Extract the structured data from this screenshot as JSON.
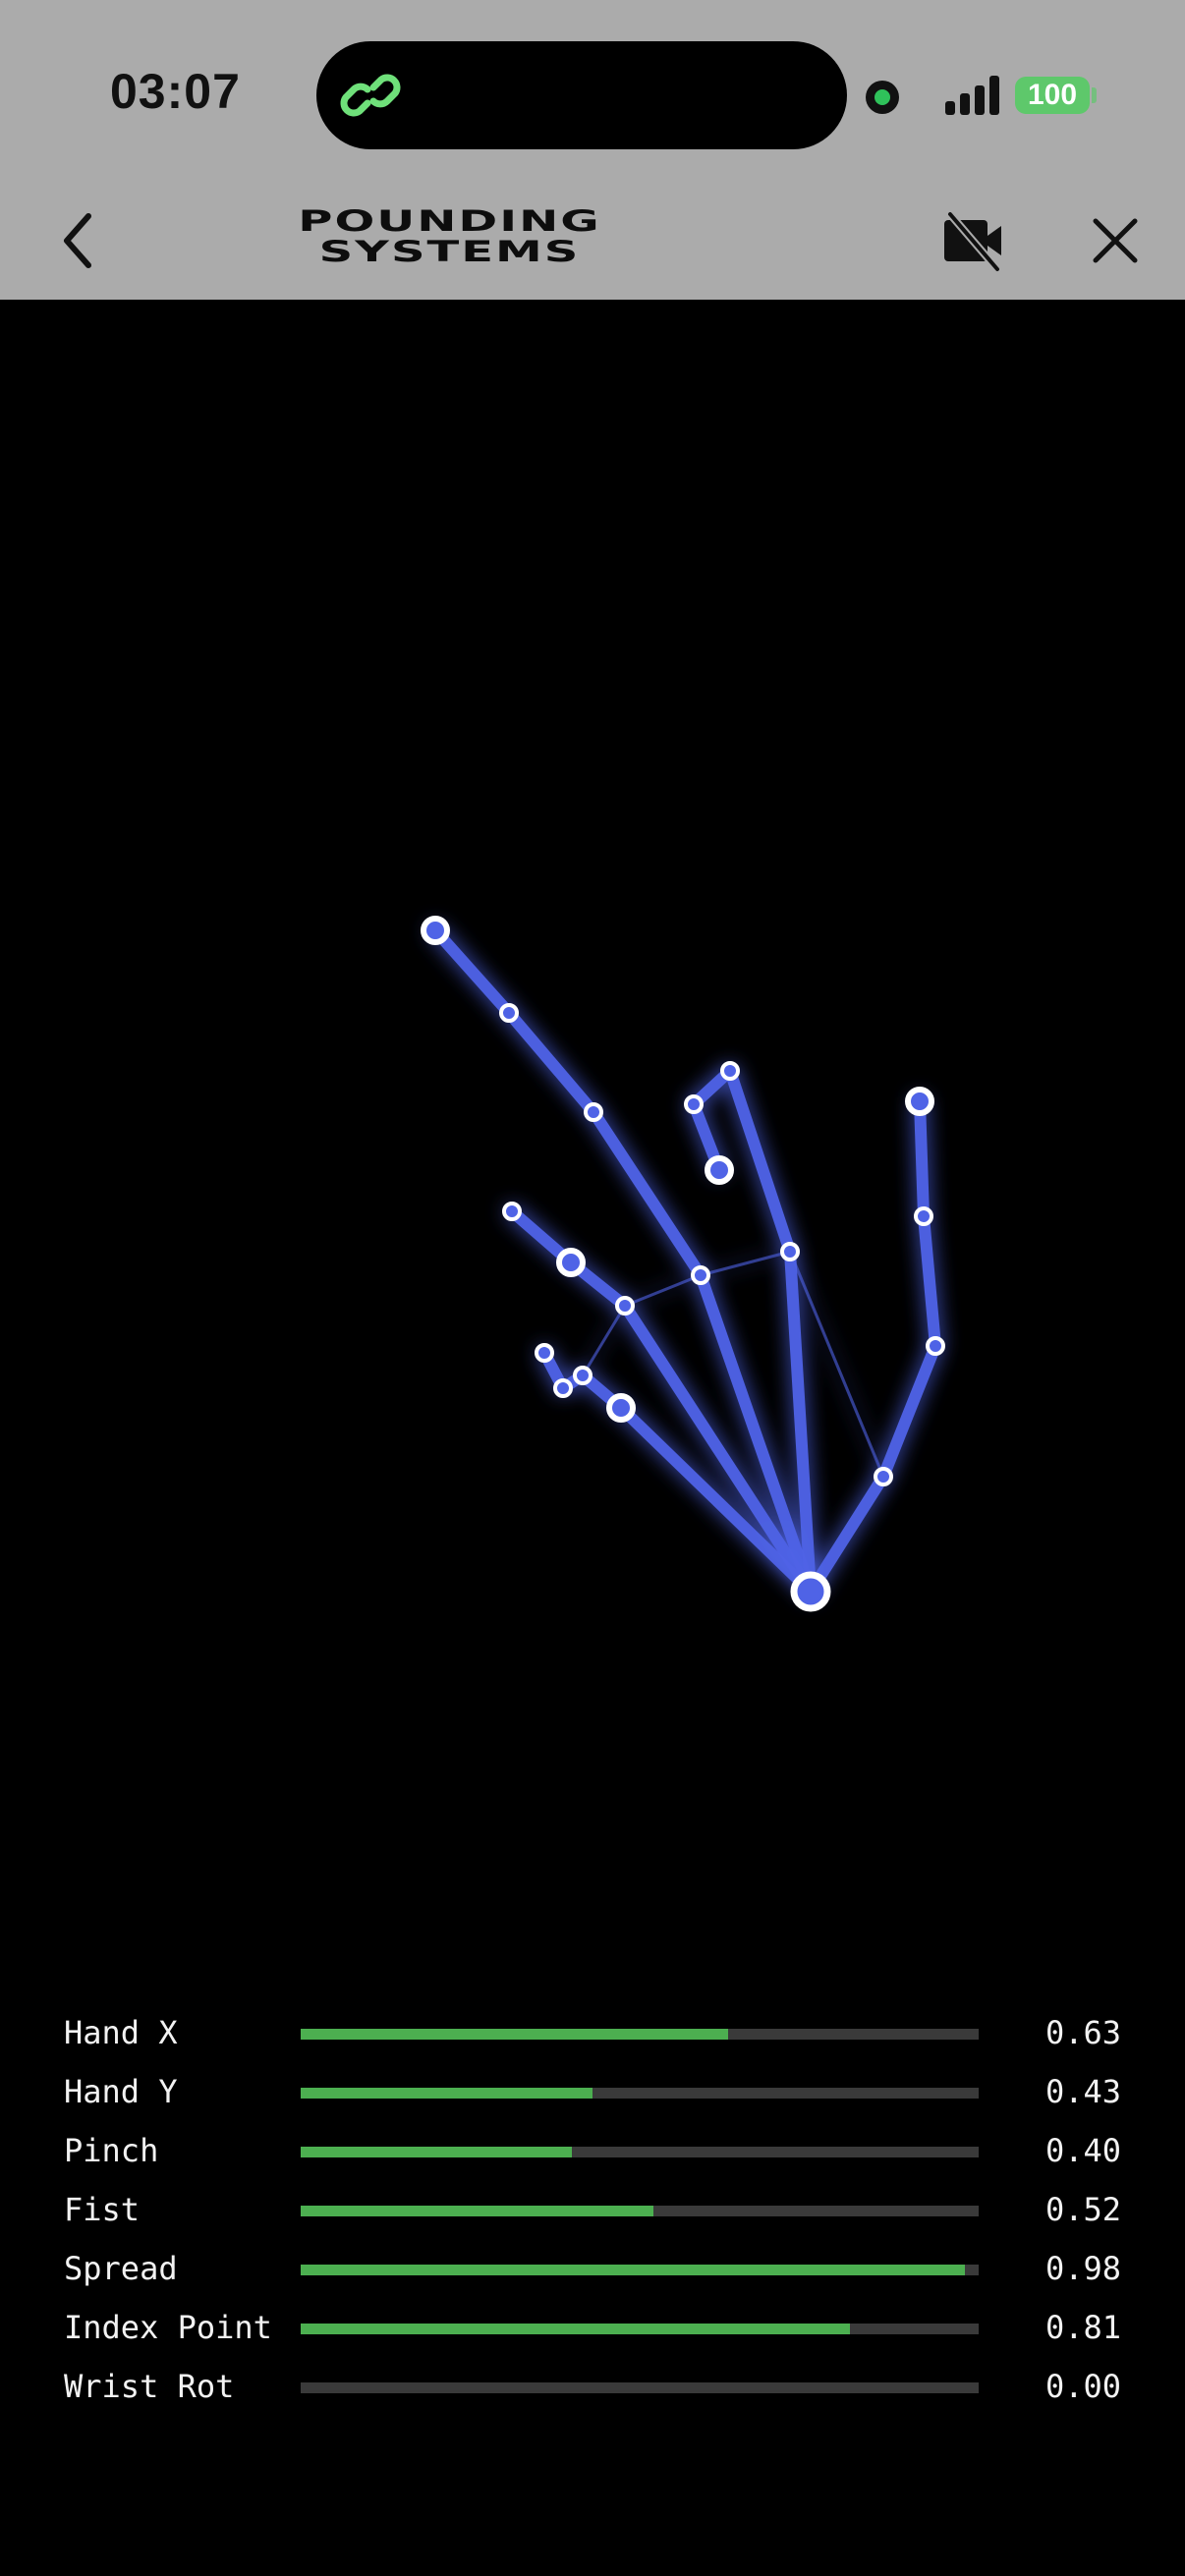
{
  "status_bar": {
    "time": "03:07",
    "battery": "100",
    "signal_bars": 4,
    "island_app_icon": "link-icon",
    "recording_indicator_color": "#2fc15a"
  },
  "header": {
    "brand_line1": "POUNDING",
    "brand_line2": "SYSTEMS",
    "back_icon": "chevron-left-icon",
    "camera_icon": "video-off-icon",
    "close_icon": "close-icon",
    "background": "#ababab"
  },
  "hand_skeleton": {
    "color": "#4f63e6",
    "joint_fill": "#ffffff"
  },
  "metrics": [
    {
      "label": "Hand X",
      "value": 0.63,
      "display": "0.63"
    },
    {
      "label": "Hand Y",
      "value": 0.43,
      "display": "0.43"
    },
    {
      "label": "Pinch",
      "value": 0.4,
      "display": "0.40"
    },
    {
      "label": "Fist",
      "value": 0.52,
      "display": "0.52"
    },
    {
      "label": "Spread",
      "value": 0.98,
      "display": "0.98"
    },
    {
      "label": "Index Point",
      "value": 0.81,
      "display": "0.81"
    },
    {
      "label": "Wrist Rot",
      "value": 0.0,
      "display": "0.00"
    }
  ],
  "colors": {
    "bar_fill": "#4caf50",
    "bar_track": "#3a3a3a"
  }
}
